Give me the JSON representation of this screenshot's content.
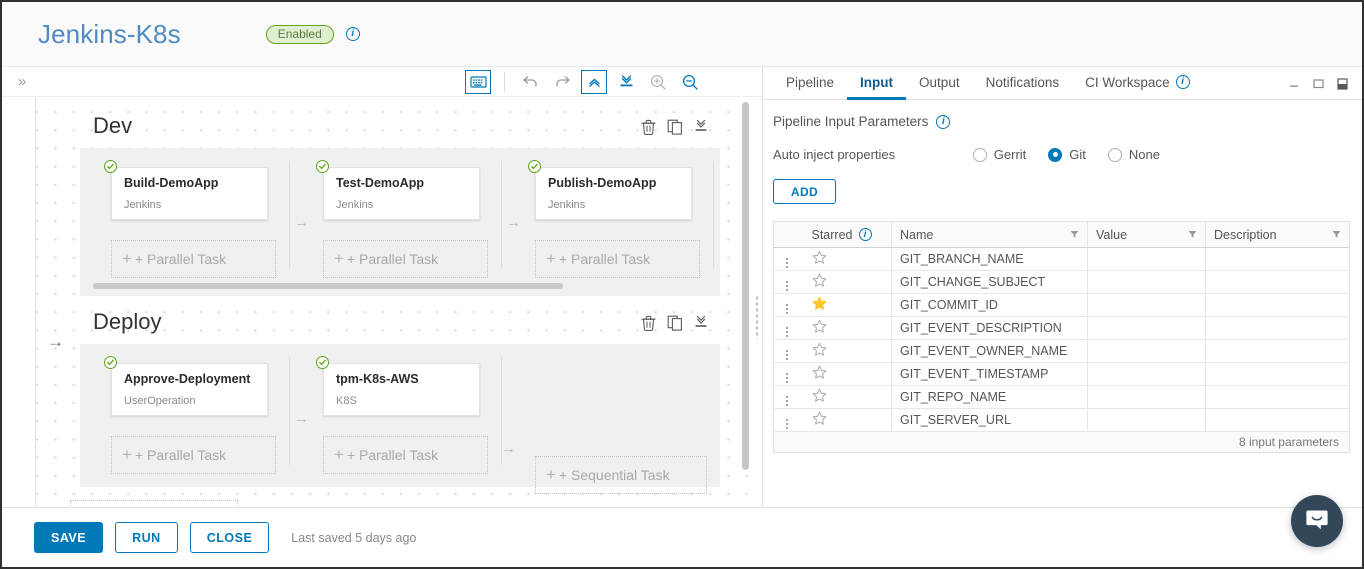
{
  "header": {
    "title": "Jenkins-K8s",
    "status_badge": "Enabled",
    "info_icon": "info-icon"
  },
  "toolbar": {
    "rail_toggle": "»",
    "buttons": [
      {
        "name": "keyboard-shortcuts-icon",
        "label": "Keyboard shortcuts"
      },
      {
        "name": "undo-icon",
        "label": "Undo"
      },
      {
        "name": "redo-icon",
        "label": "Redo"
      },
      {
        "name": "collapse-all-icon",
        "label": "Collapse all"
      },
      {
        "name": "expand-all-icon",
        "label": "Expand all"
      },
      {
        "name": "zoom-in-icon",
        "label": "Zoom in"
      },
      {
        "name": "zoom-out-icon",
        "label": "Zoom out"
      }
    ]
  },
  "canvas": {
    "stage_actions": [
      "delete-icon",
      "duplicate-icon",
      "collapse-icon"
    ],
    "parallel_task_label": "+ Parallel Task",
    "sequential_task_label": "+ Sequential Task",
    "stages": [
      {
        "name": "Dev",
        "tasks": [
          {
            "name": "Build-DemoApp",
            "type": "Jenkins",
            "status": "success"
          },
          {
            "name": "Test-DemoApp",
            "type": "Jenkins",
            "status": "success"
          },
          {
            "name": "Publish-DemoApp",
            "type": "Jenkins",
            "status": "success"
          }
        ]
      },
      {
        "name": "Deploy",
        "tasks": [
          {
            "name": "Approve-Deployment",
            "type": "UserOperation",
            "status": "success"
          },
          {
            "name": "tpm-K8s-AWS",
            "type": "K8S",
            "status": "success"
          }
        ]
      }
    ]
  },
  "panel": {
    "tabs": [
      {
        "label": "Pipeline",
        "active": false,
        "info": false
      },
      {
        "label": "Input",
        "active": true,
        "info": false
      },
      {
        "label": "Output",
        "active": false,
        "info": false
      },
      {
        "label": "Notifications",
        "active": false,
        "info": false
      },
      {
        "label": "CI Workspace",
        "active": false,
        "info": true
      }
    ],
    "window_controls": [
      "minimize-icon",
      "maximize-icon",
      "split-view-icon"
    ],
    "section_title": "Pipeline Input Parameters",
    "inject_label": "Auto inject properties",
    "inject_options": [
      {
        "label": "Gerrit",
        "selected": false
      },
      {
        "label": "Git",
        "selected": true
      },
      {
        "label": "None",
        "selected": false
      }
    ],
    "add_label": "ADD",
    "table": {
      "columns": [
        "Starred",
        "Name",
        "Value",
        "Description"
      ],
      "rows": [
        {
          "starred": false,
          "name": "GIT_BRANCH_NAME",
          "value": "",
          "description": ""
        },
        {
          "starred": false,
          "name": "GIT_CHANGE_SUBJECT",
          "value": "",
          "description": ""
        },
        {
          "starred": true,
          "name": "GIT_COMMIT_ID",
          "value": "",
          "description": ""
        },
        {
          "starred": false,
          "name": "GIT_EVENT_DESCRIPTION",
          "value": "",
          "description": ""
        },
        {
          "starred": false,
          "name": "GIT_EVENT_OWNER_NAME",
          "value": "",
          "description": ""
        },
        {
          "starred": false,
          "name": "GIT_EVENT_TIMESTAMP",
          "value": "",
          "description": ""
        },
        {
          "starred": false,
          "name": "GIT_REPO_NAME",
          "value": "",
          "description": ""
        },
        {
          "starred": false,
          "name": "GIT_SERVER_URL",
          "value": "",
          "description": ""
        }
      ],
      "footer": "8 input parameters"
    }
  },
  "footer": {
    "save_label": "SAVE",
    "run_label": "RUN",
    "close_label": "CLOSE",
    "saved_text": "Last saved 5 days ago"
  },
  "chat": {
    "icon": "chat-bubble-icon"
  },
  "colors": {
    "accent": "#0079b8",
    "title": "#4f8bc4",
    "badge_bg": "#dff0d0",
    "badge_border": "#62a420",
    "star_on": "#ffc627",
    "chat_bg": "#33475b",
    "success": "#5aa515"
  }
}
